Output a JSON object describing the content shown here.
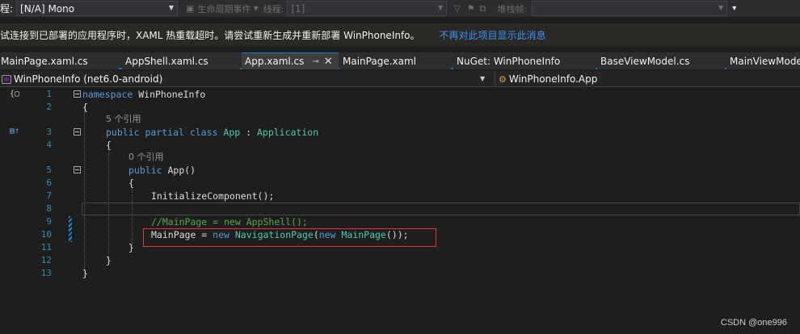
{
  "toolbar": {
    "process_label": "程:",
    "process_value": "[N/A] Mono",
    "lifecycle_label": "生命周期事件",
    "thread_label": "线程:",
    "thread_value": "[1]",
    "stackframe_label": "堆栈帧:",
    "stackframe_value": ""
  },
  "infobar": {
    "message": "试连接到已部署的应用程序时，XAML 热重载超时。请尝试重新生成并重新部署 WinPhoneInfo。",
    "link": "不再对此项目显示此消息"
  },
  "tabs": [
    {
      "label": "MainPage.xaml.cs",
      "active": false
    },
    {
      "label": "AppShell.xaml.cs",
      "active": false
    },
    {
      "label": "App.xaml.cs",
      "active": true
    },
    {
      "label": "MainPage.xaml",
      "active": false
    },
    {
      "label": "NuGet: WinPhoneInfo",
      "active": false
    },
    {
      "label": "BaseViewModel.cs",
      "active": false
    },
    {
      "label": "MainViewModel",
      "active": false
    }
  ],
  "navbar": {
    "project": "WinPhoneInfo (net6.0-android)",
    "type": "WinPhoneInfo.App"
  },
  "editor": {
    "line_numbers": [
      "1",
      "2",
      "3",
      "4",
      "5",
      "6",
      "7",
      "8",
      "9",
      "10",
      "11",
      "12",
      "13"
    ],
    "l1": {
      "kw": "namespace",
      "name": " WinPhoneInfo"
    },
    "l2": "{",
    "ref1": "5 个引用",
    "l3": {
      "kw": "public partial class",
      "name": " App",
      "colon": " : ",
      "base": "Application"
    },
    "l4": "{",
    "ref2": "0 个引用",
    "l5": {
      "kw": "public",
      "name": " App()"
    },
    "l6": "{",
    "l7": "InitializeComponent();",
    "l9": "//MainPage = new AppShell();",
    "l10": {
      "a": "MainPage = ",
      "new1": "new",
      "type1": " NavigationPage",
      "b": "(",
      "new2": "new",
      "type2": " MainPage",
      "c": "());"
    },
    "l11": "}",
    "l12": "}",
    "l13": "}"
  },
  "watermark": "CSDN @one996"
}
